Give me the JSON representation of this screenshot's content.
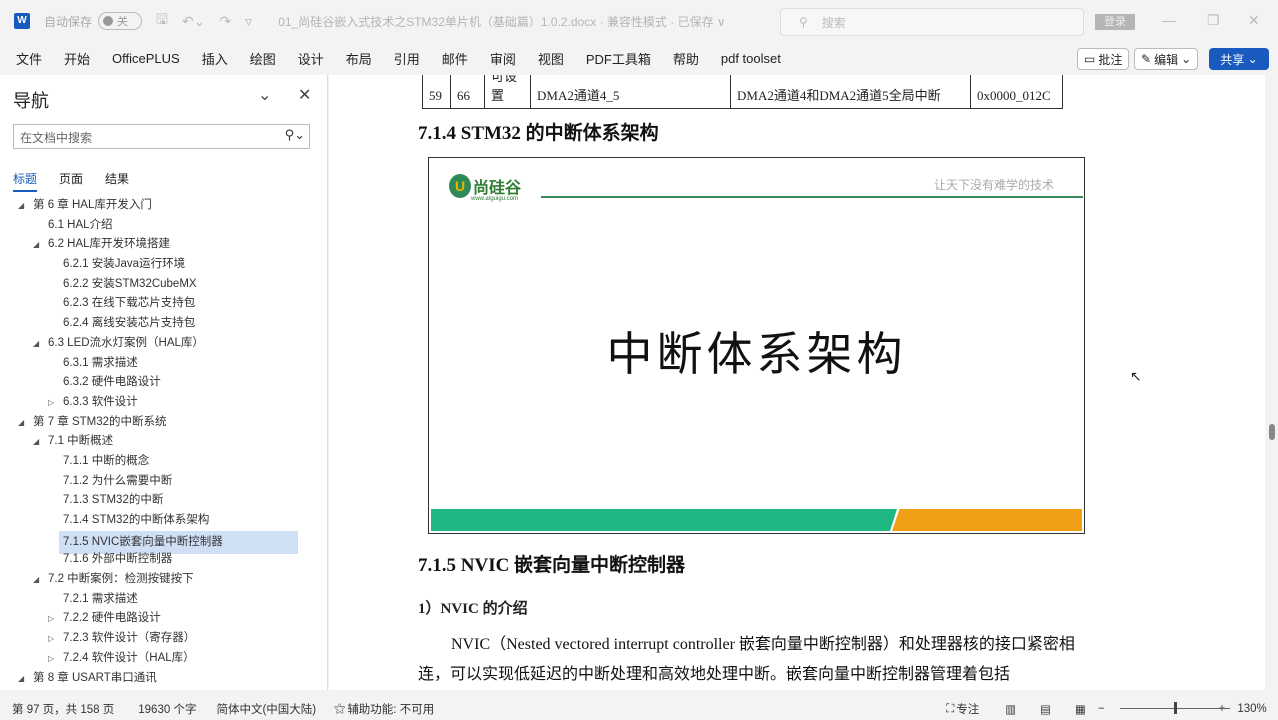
{
  "titlebar": {
    "autosave": "自动保存",
    "toggle": "关",
    "doc_title": "01_尚硅谷嵌入式技术之STM32单片机（基础篇）1.0.2.docx · 兼容性模式 · 已保存 ∨",
    "search_placeholder": "搜索",
    "login": "登录"
  },
  "ribbon": {
    "tabs": [
      "文件",
      "开始",
      "OfficePLUS",
      "插入",
      "绘图",
      "设计",
      "布局",
      "引用",
      "邮件",
      "审阅",
      "视图",
      "PDF工具箱",
      "帮助",
      "pdf toolset"
    ],
    "comment": "批注",
    "edit": "编辑",
    "share": "共享"
  },
  "nav": {
    "title": "导航",
    "search_placeholder": "在文档中搜索",
    "tabs": [
      "标题",
      "页面",
      "结果"
    ],
    "items": [
      {
        "label": "第 6 章 HAL库开发入门",
        "level": 0,
        "arrow": "expanded"
      },
      {
        "label": "6.1 HAL介绍",
        "level": 1,
        "arrow": ""
      },
      {
        "label": "6.2 HAL库开发环境搭建",
        "level": 1,
        "arrow": "expanded"
      },
      {
        "label": "6.2.1 安装Java运行环境",
        "level": 2,
        "arrow": ""
      },
      {
        "label": "6.2.2 安装STM32CubeMX",
        "level": 2,
        "arrow": ""
      },
      {
        "label": "6.2.3 在线下载芯片支持包",
        "level": 2,
        "arrow": ""
      },
      {
        "label": "6.2.4 离线安装芯片支持包",
        "level": 2,
        "arrow": ""
      },
      {
        "label": "6.3 LED流水灯案例（HAL库）",
        "level": 1,
        "arrow": "expanded"
      },
      {
        "label": "6.3.1 需求描述",
        "level": 2,
        "arrow": ""
      },
      {
        "label": "6.3.2 硬件电路设计",
        "level": 2,
        "arrow": ""
      },
      {
        "label": "6.3.3 软件设计",
        "level": 2,
        "arrow": "collapsed"
      },
      {
        "label": "第 7 章 STM32的中断系统",
        "level": 0,
        "arrow": "expanded"
      },
      {
        "label": "7.1 中断概述",
        "level": 1,
        "arrow": "expanded"
      },
      {
        "label": "7.1.1 中断的概念",
        "level": 2,
        "arrow": ""
      },
      {
        "label": "7.1.2 为什么需要中断",
        "level": 2,
        "arrow": ""
      },
      {
        "label": "7.1.3 STM32的中断",
        "level": 2,
        "arrow": ""
      },
      {
        "label": "7.1.4 STM32的中断体系架构",
        "level": 2,
        "arrow": ""
      },
      {
        "label": "7.1.5 NVIC嵌套向量中断控制器",
        "level": 2,
        "arrow": "",
        "selected": true
      },
      {
        "label": "7.1.6 外部中断控制器",
        "level": 2,
        "arrow": ""
      },
      {
        "label": "7.2 中断案例：检测按键按下",
        "level": 1,
        "arrow": "expanded"
      },
      {
        "label": "7.2.1 需求描述",
        "level": 2,
        "arrow": ""
      },
      {
        "label": "7.2.2 硬件电路设计",
        "level": 2,
        "arrow": "collapsed"
      },
      {
        "label": "7.2.3 软件设计（寄存器）",
        "level": 2,
        "arrow": "collapsed"
      },
      {
        "label": "7.2.4 软件设计（HAL库）",
        "level": 2,
        "arrow": "collapsed"
      },
      {
        "label": "第 8 章 USART串口通讯",
        "level": 0,
        "arrow": "expanded"
      }
    ]
  },
  "doc": {
    "table_row": [
      "59",
      "66",
      "可设置",
      "DMA2通道4_5",
      "DMA2通道4和DMA2通道5全局中断",
      "0x0000_012C"
    ],
    "h_714": "7.1.4 STM32 的中断体系架构",
    "slide": {
      "brand": "尚硅谷",
      "url": "www.atguigu.com",
      "motto": "让天下没有难学的技术",
      "title": "中断体系架构"
    },
    "h_715": "7.1.5 NVIC 嵌套向量中断控制器",
    "h_nvic": "1）NVIC 的介绍",
    "para": "NVIC（Nested vectored interrupt controller 嵌套向量中断控制器）和处理器核的接口紧密相连，可以实现低延迟的中断处理和高效地处理中断。嵌套向量中断控制器管理着包括"
  },
  "status": {
    "page": "第 97 页，共 158 页",
    "words": "19630 个字",
    "lang": "简体中文(中国大陆)",
    "access": "辅助功能: 不可用",
    "focus": "专注",
    "zoom": "130%"
  }
}
